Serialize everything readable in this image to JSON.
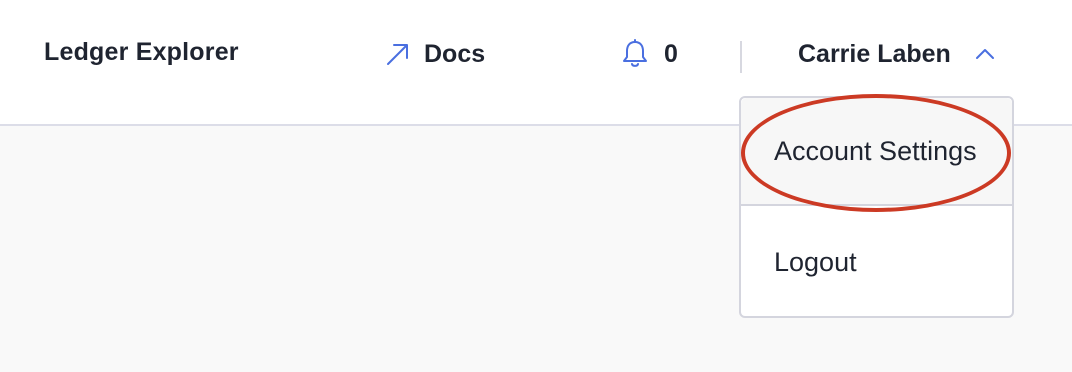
{
  "header": {
    "app_title": "Ledger Explorer",
    "docs_label": "Docs",
    "docs_icon": "arrow-up-right-icon",
    "notifications_icon": "bell-icon",
    "notifications_count": "0",
    "user_name": "Carrie Laben",
    "user_menu_icon": "chevron-up-icon"
  },
  "dropdown": {
    "items": [
      {
        "label": "Account Settings",
        "highlighted": true
      },
      {
        "label": "Logout"
      }
    ]
  },
  "colors": {
    "accent": "#4a6fe0",
    "highlight_ring": "#cc3a24",
    "text": "#1f2430",
    "background": "#f9f9f9"
  }
}
